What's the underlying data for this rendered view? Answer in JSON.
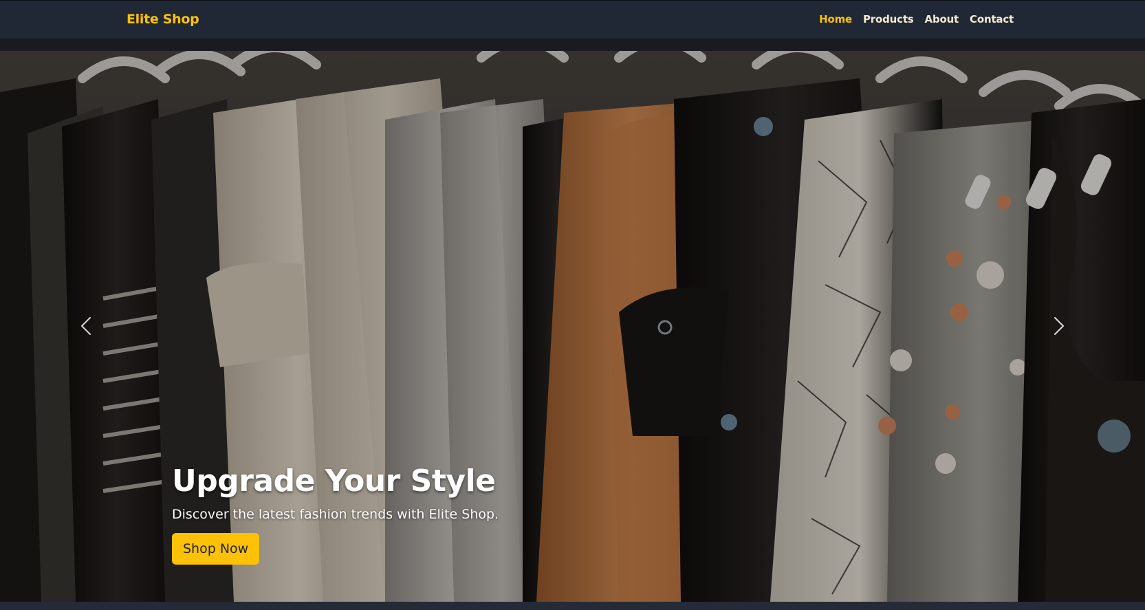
{
  "navbar": {
    "brand": "Elite Shop",
    "links": [
      {
        "label": "Home",
        "active": true
      },
      {
        "label": "Products",
        "active": false
      },
      {
        "label": "About",
        "active": false
      },
      {
        "label": "Contact",
        "active": false
      }
    ]
  },
  "hero": {
    "title": "Upgrade Your Style",
    "subtitle": "Discover the latest fashion trends with Elite Shop.",
    "cta_label": "Shop Now",
    "prev_icon": "chevron-left-icon",
    "next_icon": "chevron-right-icon"
  },
  "colors": {
    "accent": "#ffc107",
    "navbar_bg": "#212835",
    "nav_text": "#f3e9cf",
    "page_bg": "#1b1c1f"
  }
}
